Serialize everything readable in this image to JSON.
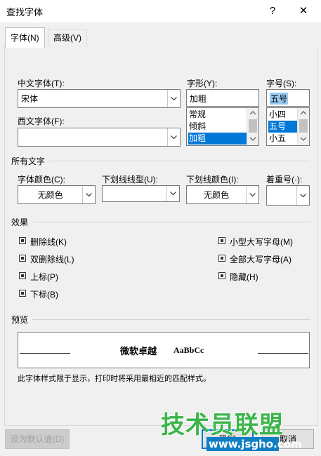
{
  "window": {
    "title": "查找字体",
    "help": "?",
    "close": "✕"
  },
  "tabs": [
    {
      "label": "字体(N)"
    },
    {
      "label": "高级(V)"
    }
  ],
  "font": {
    "cn_label": "中文字体(T):",
    "cn_value": "宋体",
    "west_label": "西文字体(F):",
    "west_value": "",
    "style_label": "字形(Y):",
    "style_value": "加粗",
    "style_options": [
      "常规",
      "倾斜",
      "加粗"
    ],
    "style_selected": "加粗",
    "size_label": "字号(S):",
    "size_value": "五号",
    "size_options": [
      "小四",
      "五号",
      "小五"
    ],
    "size_selected": "五号"
  },
  "all_text": {
    "section": "所有文字",
    "color_label": "字体颜色(C):",
    "color_value": "无颜色",
    "underline_label": "下划线线型(U):",
    "underline_value": "",
    "underline_color_label": "下划线颜色(I):",
    "underline_color_value": "无颜色",
    "emphasis_label": "着重号(·):",
    "emphasis_value": ""
  },
  "effects": {
    "section": "效果",
    "left": [
      "删除线(K)",
      "双删除线(L)",
      "上标(P)",
      "下标(B)"
    ],
    "right": [
      "小型大写字母(M)",
      "全部大写字母(A)",
      "隐藏(H)"
    ]
  },
  "preview": {
    "section": "预览",
    "sample_cn": "微软卓越",
    "sample_en": "AaBbCc",
    "note": "此字体样式限于显示，打印时将采用最相近的匹配样式。"
  },
  "buttons": {
    "default": "设为默认值(D)",
    "ok": "确定",
    "cancel": "取消"
  },
  "watermark": {
    "text": "技术员联盟",
    "url": "www.jsgho.com"
  }
}
